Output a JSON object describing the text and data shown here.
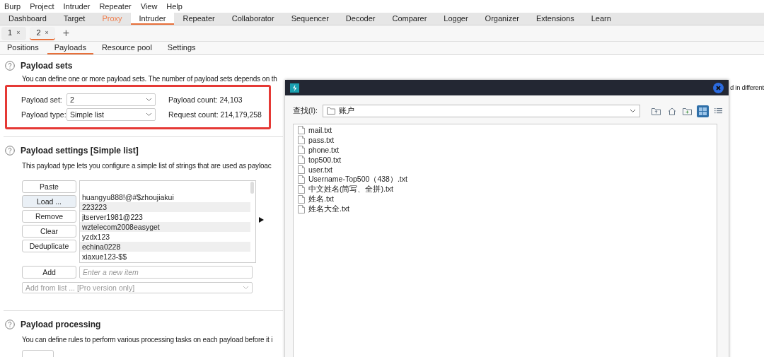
{
  "menu": [
    "Burp",
    "Project",
    "Intruder",
    "Repeater",
    "View",
    "Help"
  ],
  "main_tabs": [
    {
      "label": "Dashboard",
      "selected": false,
      "highlighted": false
    },
    {
      "label": "Target",
      "selected": false,
      "highlighted": false
    },
    {
      "label": "Proxy",
      "selected": false,
      "highlighted": true
    },
    {
      "label": "Intruder",
      "selected": true,
      "highlighted": false
    },
    {
      "label": "Repeater",
      "selected": false,
      "highlighted": false
    },
    {
      "label": "Collaborator",
      "selected": false,
      "highlighted": false
    },
    {
      "label": "Sequencer",
      "selected": false,
      "highlighted": false
    },
    {
      "label": "Decoder",
      "selected": false,
      "highlighted": false
    },
    {
      "label": "Comparer",
      "selected": false,
      "highlighted": false
    },
    {
      "label": "Logger",
      "selected": false,
      "highlighted": false
    },
    {
      "label": "Organizer",
      "selected": false,
      "highlighted": false
    },
    {
      "label": "Extensions",
      "selected": false,
      "highlighted": false
    },
    {
      "label": "Learn",
      "selected": false,
      "highlighted": false
    }
  ],
  "request_tabs": [
    {
      "label": "1",
      "close": "×",
      "selected": false
    },
    {
      "label": "2",
      "close": "×",
      "selected": true
    }
  ],
  "new_tab": "+",
  "sub_tabs": [
    {
      "label": "Positions",
      "selected": false
    },
    {
      "label": "Payloads",
      "selected": true
    },
    {
      "label": "Resource pool",
      "selected": false
    },
    {
      "label": "Settings",
      "selected": false
    }
  ],
  "payload_sets": {
    "title": "Payload sets",
    "description": "You can define one or more payload sets. The number of payload sets depends on th",
    "description_tail": "d in different",
    "set_label": "Payload set:",
    "set_value": "2",
    "type_label": "Payload type:",
    "type_value": "Simple list",
    "count_label": "Payload count:",
    "count_value": "24,103",
    "request_label": "Request count:",
    "request_value": "214,179,258"
  },
  "payload_settings": {
    "title": "Payload settings [Simple list]",
    "description": "This payload type lets you configure a simple list of strings that are used as payloac",
    "buttons": [
      {
        "label": "Paste",
        "focused": false
      },
      {
        "label": "Load ...",
        "focused": true
      },
      {
        "label": "Remove",
        "focused": false
      },
      {
        "label": "Clear",
        "focused": false
      },
      {
        "label": "Deduplicate",
        "focused": false
      }
    ],
    "items": [
      "huangyu888!@#$zhoujiakui",
      "223223",
      "jtserver1981@223",
      "wztelecom2008easyget",
      "yzdx123",
      "echina0228",
      "xiaxue123-$$"
    ],
    "add_button": "Add",
    "add_placeholder": "Enter a new item",
    "add_from_list": "Add from list ... [Pro version only]",
    "add_from_list_disabled": true
  },
  "payload_processing": {
    "title": "Payload processing",
    "description": "You can define rules to perform various processing tasks on each payload before it i"
  },
  "dialog": {
    "look_in_label": "查找(I):",
    "folder": "账户",
    "toolbar": [
      {
        "kind": "up",
        "selected": false
      },
      {
        "kind": "home",
        "selected": false
      },
      {
        "kind": "new-folder",
        "selected": false
      },
      {
        "kind": "grid",
        "selected": true
      },
      {
        "kind": "list",
        "selected": false
      }
    ],
    "files": [
      "mail.txt",
      "pass.txt",
      "phone.txt",
      "top500.txt",
      "user.txt",
      "Username-Top500（438）.txt",
      "中文姓名(简写、全拼).txt",
      "姓名.txt",
      "姓名大全.txt"
    ]
  }
}
